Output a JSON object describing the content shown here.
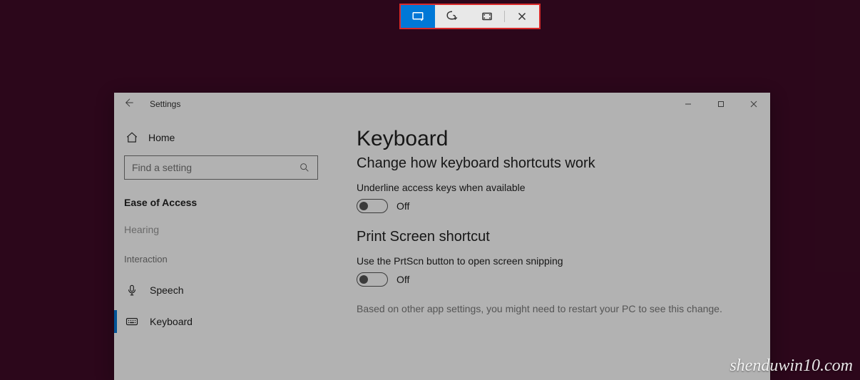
{
  "snip_toolbar": {
    "rect_icon": "rectangle-snip-icon",
    "freeform_icon": "freeform-snip-icon",
    "fullscreen_icon": "fullscreen-snip-icon",
    "close_icon": "close-icon"
  },
  "window": {
    "title": "Settings",
    "controls": {
      "minimize": "minimize",
      "maximize": "maximize",
      "close": "close"
    }
  },
  "sidebar": {
    "home_label": "Home",
    "search_placeholder": "Find a setting",
    "category": "Ease of Access",
    "truncated_item": "Hearing",
    "subheader": "Interaction",
    "items": [
      {
        "icon": "microphone-icon",
        "label": "Speech",
        "active": false
      },
      {
        "icon": "keyboard-icon",
        "label": "Keyboard",
        "active": true
      }
    ]
  },
  "main": {
    "heading": "Keyboard",
    "subheading": "Change how keyboard shortcuts work",
    "setting1_label": "Underline access keys when available",
    "setting1_state": "Off",
    "section2_title": "Print Screen shortcut",
    "setting2_label": "Use the PrtScn button to open screen snipping",
    "setting2_state": "Off",
    "note": "Based on other app settings, you might need to restart your PC to see this change."
  },
  "watermark": "shenduwin10.com"
}
